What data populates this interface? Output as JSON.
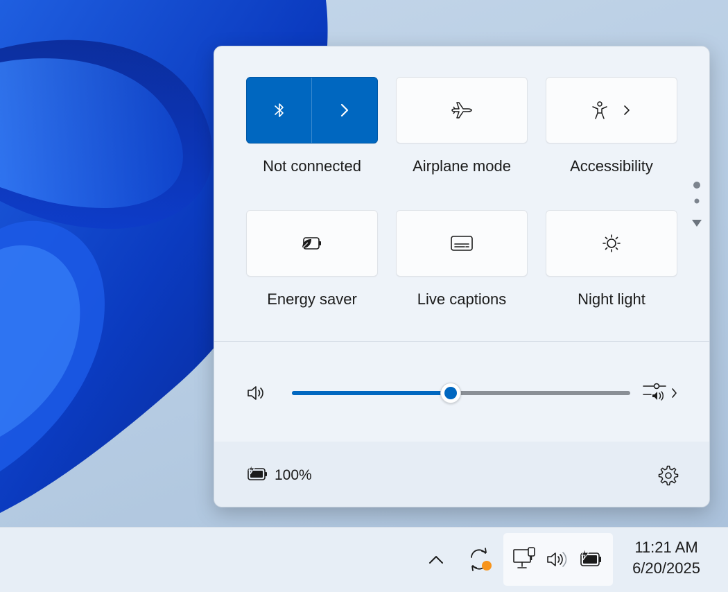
{
  "quick_settings": {
    "tiles": [
      {
        "label": "Not connected",
        "icon": "bluetooth-icon",
        "secondary_icon": "chevron-right-icon",
        "active": true
      },
      {
        "label": "Airplane mode",
        "icon": "airplane-icon",
        "active": false
      },
      {
        "label": "Accessibility",
        "icon": "accessibility-icon",
        "secondary_icon": "chevron-right-icon",
        "active": false
      },
      {
        "label": "Energy saver",
        "icon": "energy-saver-icon",
        "active": false
      },
      {
        "label": "Live captions",
        "icon": "live-captions-icon",
        "active": false
      },
      {
        "label": "Night light",
        "icon": "night-light-icon",
        "active": false
      }
    ],
    "pager": {
      "current_page": 1,
      "pages": 2
    },
    "volume": {
      "level_fraction": 0.47,
      "icon": "speaker-icon",
      "mixer_icon": "sound-mixer-icon"
    },
    "battery": {
      "percent_text": "100%",
      "icon": "battery-charging-icon"
    },
    "settings_icon": "gear-icon"
  },
  "taskbar": {
    "tray_icons": [
      "chevron-up-icon",
      "sync-icon",
      "network-icon",
      "speaker-icon",
      "battery-charging-icon"
    ],
    "clock": {
      "time": "11:21 AM",
      "date": "6/20/2025"
    }
  },
  "colors": {
    "accent": "#0067c0",
    "notification_dot": "#f7941d",
    "wallpaper_deep": "#0a2fa8"
  }
}
